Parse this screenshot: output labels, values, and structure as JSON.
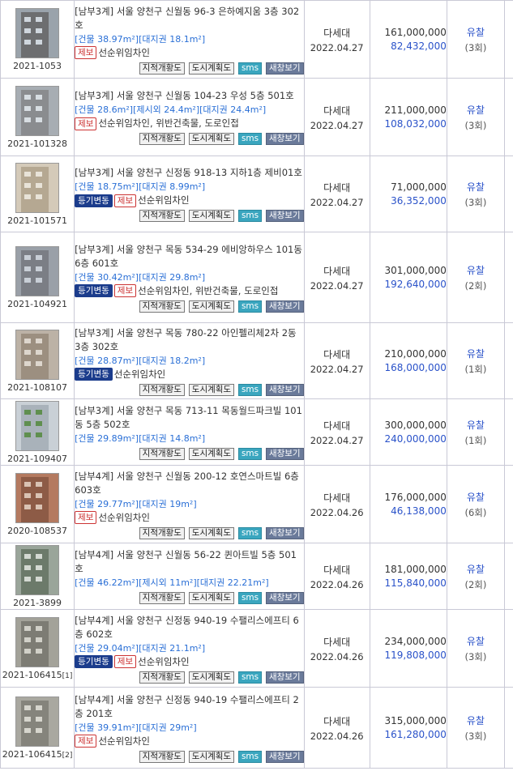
{
  "buttons": {
    "map": "지적개황도",
    "plan": "도시계획도",
    "sms": "sms",
    "newwin": "새창보기"
  },
  "items": [
    {
      "case": "2021-1053",
      "suffix": "",
      "court": "[남부3계]",
      "addr": "서울 양천구 신월동 96-3 은하예지움 3층 302호",
      "area": "[건물 38.97m²][대지권 18.1m²]",
      "tags": [
        "제보"
      ],
      "warn": "선순위임차인",
      "type": "다세대",
      "date": "2022.04.27",
      "appraisal": "161,000,000",
      "min": "82,432,000",
      "status": "유찰",
      "count": "(3회)",
      "bg": "#6d6e70",
      "bg2": "#9aa3ab",
      "win": "#cfd6dd",
      "h": 96
    },
    {
      "case": "2021-101328",
      "suffix": "",
      "court": "[남부3계]",
      "addr": "서울 양천구 신월동 104-23 우성 5층 501호",
      "area": "[건물 28.6m²][제시외 24.4m²][대지권 24.4m²]",
      "tags": [
        "제보"
      ],
      "warn": "선순위임차인, 위반건축물, 도로인접",
      "type": "다세대",
      "date": "2022.04.27",
      "appraisal": "211,000,000",
      "min": "108,032,000",
      "status": "유찰",
      "count": "(3회)",
      "bg": "#8a8c8f",
      "bg2": "#a7adb3",
      "win": "#d7dde2",
      "h": 96
    },
    {
      "case": "2021-101571",
      "suffix": "",
      "court": "[남부3계]",
      "addr": "서울 양천구 신정동 918-13 지하1층 제비01호",
      "area": "[건물 18.75m²][대지권 8.99m²]",
      "tags": [
        "등기변동",
        "제보"
      ],
      "warn": "선순위임차인",
      "type": "다세대",
      "date": "2022.04.27",
      "appraisal": "71,000,000",
      "min": "36,352,000",
      "status": "유찰",
      "count": "(3회)",
      "bg": "#b5a892",
      "bg2": "#d4cab9",
      "win": "#e8e3d8",
      "h": 94
    },
    {
      "case": "2021-104921",
      "suffix": "",
      "court": "[남부3계]",
      "addr": "서울 양천구 목동 534-29 에비앙하우스 101동 6층 601호",
      "area": "[건물 30.42m²][대지권 29.8m²]",
      "tags": [
        "등기변동",
        "제보"
      ],
      "warn": "선순위임차인, 위반건축물, 도로인접",
      "type": "다세대",
      "date": "2022.04.27",
      "appraisal": "301,000,000",
      "min": "192,640,000",
      "status": "유찰",
      "count": "(2회)",
      "bg": "#7b7e85",
      "bg2": "#9aa0a8",
      "win": "#c8ced6",
      "h": 112
    },
    {
      "case": "2021-108107",
      "suffix": "",
      "court": "[남부3계]",
      "addr": "서울 양천구 목동 780-22 아인펠리체2차 2동 3층 302호",
      "area": "[건물 28.87m²][대지권 18.2m²]",
      "tags": [
        "등기변동"
      ],
      "warn": "선순위임차인",
      "type": "다세대",
      "date": "2022.04.27",
      "appraisal": "210,000,000",
      "min": "168,000,000",
      "status": "유찰",
      "count": "(1회)",
      "bg": "#9c8f80",
      "bg2": "#bcb2a6",
      "win": "#ddd6cd",
      "h": 94
    },
    {
      "case": "2021-109407",
      "suffix": "",
      "court": "[남부3계]",
      "addr": "서울 양천구 목동 713-11 목동월드파크빌 101동 5층 502호",
      "area": "[건물 29.89m²][대지권 14.8m²]",
      "tags": [],
      "warn": "",
      "type": "다세대",
      "date": "2022.04.27",
      "appraisal": "300,000,000",
      "min": "240,000,000",
      "status": "유찰",
      "count": "(1회)",
      "bg": "#a9b2ba",
      "bg2": "#c9d0d6",
      "win": "#5f8f4f",
      "h": 82
    },
    {
      "case": "2020-108537",
      "suffix": "",
      "court": "[남부4계]",
      "addr": "서울 양천구 신월동 200-12 호연스마트빌 6층 603호",
      "area": "[건물 29.77m²][대지권 19m²]",
      "tags": [
        "제보"
      ],
      "warn": "선순위임차인",
      "type": "다세대",
      "date": "2022.04.26",
      "appraisal": "176,000,000",
      "min": "46,138,000",
      "status": "유찰",
      "count": "(6회)",
      "bg": "#8d5b46",
      "bg2": "#b47a60",
      "win": "#d9c2b3",
      "h": 96
    },
    {
      "case": "2021-3899",
      "suffix": "",
      "court": "[남부4계]",
      "addr": "서울 양천구 신월동 56-22 퀸아트빌 5층 501호",
      "area": "[건물 46.22m²][제시외 11m²][대지권 22.21m²]",
      "tags": [],
      "warn": "",
      "type": "다세대",
      "date": "2022.04.26",
      "appraisal": "181,000,000",
      "min": "115,840,000",
      "status": "유찰",
      "count": "(2회)",
      "bg": "#6c7a6a",
      "bg2": "#9aa59a",
      "win": "#d4d9d2",
      "h": 82
    },
    {
      "case": "2021-106415",
      "suffix": "[1]",
      "court": "[남부4계]",
      "addr": "서울 양천구 신정동 940-19 수팰리스에프티 6층 602호",
      "area": "[건물 29.04m²][대지권 21.1m²]",
      "tags": [
        "등기변동",
        "제보"
      ],
      "warn": "선순위임차인",
      "type": "다세대",
      "date": "2022.04.26",
      "appraisal": "234,000,000",
      "min": "119,808,000",
      "status": "유찰",
      "count": "(3회)",
      "bg": "#7d7c74",
      "bg2": "#a3a299",
      "win": "#d1d0c8",
      "h": 96
    },
    {
      "case": "2021-106415",
      "suffix": "[2]",
      "court": "[남부4계]",
      "addr": "서울 양천구 신정동 940-19 수팰리스에프티 2층 201호",
      "area": "[건물 39.91m²][대지권 29m²]",
      "tags": [
        "제보"
      ],
      "warn": "선순위임차인",
      "type": "다세대",
      "date": "2022.04.26",
      "appraisal": "315,000,000",
      "min": "161,280,000",
      "status": "유찰",
      "count": "(3회)",
      "bg": "#85847c",
      "bg2": "#a9a8a0",
      "win": "#d6d5cd",
      "h": 100
    }
  ]
}
